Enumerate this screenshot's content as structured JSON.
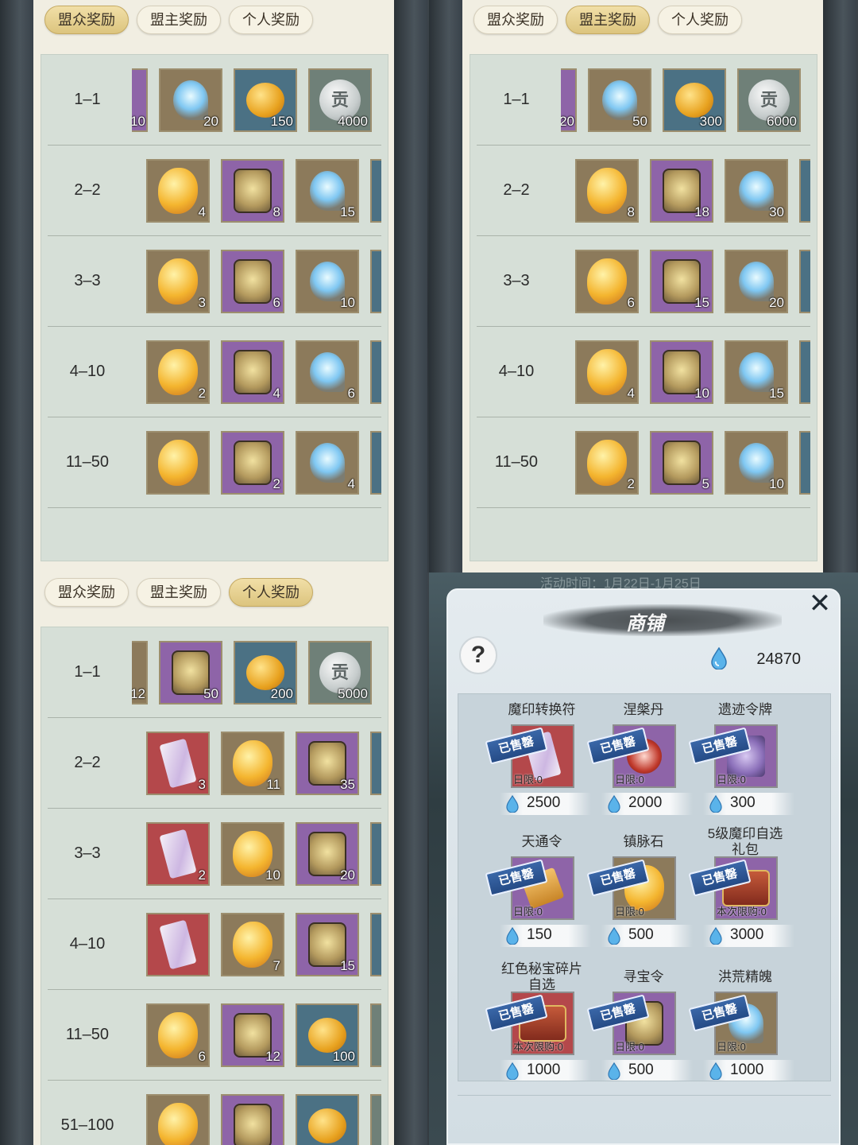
{
  "tabs": [
    "盟众奖励",
    "盟主奖励",
    "个人奖励"
  ],
  "panels": [
    {
      "active_tab": 0,
      "rows": [
        {
          "rank": "1–1",
          "items": [
            {
              "type": "partial-purple",
              "count": "10"
            },
            {
              "type": "swirl",
              "q": "brown",
              "count": "20"
            },
            {
              "type": "egg",
              "q": "blue",
              "count": "150"
            },
            {
              "type": "medal",
              "q": "gray",
              "count": "4000",
              "glyph": "贡"
            }
          ]
        },
        {
          "rank": "2–2",
          "items": [
            {
              "type": "stone",
              "q": "brown",
              "count": "4"
            },
            {
              "type": "token",
              "q": "purple",
              "count": "8"
            },
            {
              "type": "swirl",
              "q": "brown",
              "count": "15"
            },
            {
              "type": "partial-blue"
            }
          ]
        },
        {
          "rank": "3–3",
          "items": [
            {
              "type": "stone",
              "q": "brown",
              "count": "3"
            },
            {
              "type": "token",
              "q": "purple",
              "count": "6"
            },
            {
              "type": "swirl",
              "q": "brown",
              "count": "10"
            },
            {
              "type": "partial-blue"
            }
          ]
        },
        {
          "rank": "4–10",
          "items": [
            {
              "type": "stone",
              "q": "brown",
              "count": "2"
            },
            {
              "type": "token",
              "q": "purple",
              "count": "4"
            },
            {
              "type": "swirl",
              "q": "brown",
              "count": "6"
            },
            {
              "type": "partial-blue"
            }
          ]
        },
        {
          "rank": "11–50",
          "items": [
            {
              "type": "stone",
              "q": "brown",
              "count": ""
            },
            {
              "type": "token",
              "q": "purple",
              "count": "2"
            },
            {
              "type": "swirl",
              "q": "brown",
              "count": "4"
            },
            {
              "type": "partial-blue"
            }
          ]
        }
      ]
    },
    {
      "active_tab": 1,
      "rows": [
        {
          "rank": "1–1",
          "items": [
            {
              "type": "partial-purple",
              "count": "20"
            },
            {
              "type": "swirl",
              "q": "brown",
              "count": "50"
            },
            {
              "type": "egg",
              "q": "blue",
              "count": "300"
            },
            {
              "type": "medal",
              "q": "gray",
              "count": "6000",
              "glyph": "贡"
            }
          ]
        },
        {
          "rank": "2–2",
          "items": [
            {
              "type": "stone",
              "q": "brown",
              "count": "8"
            },
            {
              "type": "token",
              "q": "purple",
              "count": "18"
            },
            {
              "type": "swirl",
              "q": "brown",
              "count": "30"
            },
            {
              "type": "partial-blue"
            }
          ]
        },
        {
          "rank": "3–3",
          "items": [
            {
              "type": "stone",
              "q": "brown",
              "count": "6"
            },
            {
              "type": "token",
              "q": "purple",
              "count": "15"
            },
            {
              "type": "swirl",
              "q": "brown",
              "count": "20"
            },
            {
              "type": "partial-blue"
            }
          ]
        },
        {
          "rank": "4–10",
          "items": [
            {
              "type": "stone",
              "q": "brown",
              "count": "4"
            },
            {
              "type": "token",
              "q": "purple",
              "count": "10"
            },
            {
              "type": "swirl",
              "q": "brown",
              "count": "15"
            },
            {
              "type": "partial-blue"
            }
          ]
        },
        {
          "rank": "11–50",
          "items": [
            {
              "type": "stone",
              "q": "brown",
              "count": "2"
            },
            {
              "type": "token",
              "q": "purple",
              "count": "5"
            },
            {
              "type": "swirl",
              "q": "brown",
              "count": "10"
            },
            {
              "type": "partial-blue"
            }
          ]
        }
      ]
    },
    {
      "active_tab": 2,
      "rows": [
        {
          "rank": "1–1",
          "items": [
            {
              "type": "partial-brown",
              "count": "12"
            },
            {
              "type": "token",
              "q": "purple",
              "count": "50"
            },
            {
              "type": "egg",
              "q": "blue",
              "count": "200"
            },
            {
              "type": "medal",
              "q": "gray",
              "count": "5000",
              "glyph": "贡"
            }
          ]
        },
        {
          "rank": "2–2",
          "items": [
            {
              "type": "scroll",
              "q": "red",
              "count": "3"
            },
            {
              "type": "stone",
              "q": "brown",
              "count": "11"
            },
            {
              "type": "token",
              "q": "purple",
              "count": "35"
            },
            {
              "type": "partial-blue"
            }
          ]
        },
        {
          "rank": "3–3",
          "items": [
            {
              "type": "scroll",
              "q": "red",
              "count": "2"
            },
            {
              "type": "stone",
              "q": "brown",
              "count": "10"
            },
            {
              "type": "token",
              "q": "purple",
              "count": "20"
            },
            {
              "type": "partial-blue"
            }
          ]
        },
        {
          "rank": "4–10",
          "items": [
            {
              "type": "scroll",
              "q": "red",
              "count": ""
            },
            {
              "type": "stone",
              "q": "brown",
              "count": "7"
            },
            {
              "type": "token",
              "q": "purple",
              "count": "15"
            },
            {
              "type": "partial-blue"
            }
          ]
        },
        {
          "rank": "11–50",
          "items": [
            {
              "type": "stone",
              "q": "brown",
              "count": "6"
            },
            {
              "type": "token",
              "q": "purple",
              "count": "12"
            },
            {
              "type": "egg",
              "q": "blue",
              "count": "100"
            },
            {
              "type": "partial-gray"
            }
          ]
        },
        {
          "rank": "51–100",
          "items": [
            {
              "type": "stone",
              "q": "brown",
              "count": ""
            },
            {
              "type": "token",
              "q": "purple",
              "count": ""
            },
            {
              "type": "egg",
              "q": "blue",
              "count": ""
            },
            {
              "type": "partial-gray"
            }
          ]
        }
      ]
    }
  ],
  "shop": {
    "event_time": "活动时间：1月22日-1月25日",
    "title": "商铺",
    "close_glyph": "✕",
    "help_glyph": "?",
    "balance": "24870",
    "sold_label": "已售罄",
    "items": [
      {
        "name": "魔印转换符",
        "icon": "scroll",
        "q": "red",
        "limit": "日限:0",
        "price": "2500"
      },
      {
        "name": "涅槃丹",
        "icon": "fist",
        "q": "purple",
        "limit": "日限:0",
        "price": "2000"
      },
      {
        "name": "遗迹令牌",
        "icon": "badge",
        "q": "purple",
        "limit": "日限:0",
        "price": "300"
      },
      {
        "name": "天通令",
        "icon": "flag",
        "q": "purple",
        "limit": "日限:0",
        "price": "150"
      },
      {
        "name": "镇脉石",
        "icon": "stone",
        "q": "brown",
        "limit": "日限:0",
        "price": "500"
      },
      {
        "name": "5级魔印自选\n礼包",
        "icon": "chest",
        "q": "purple",
        "limit": "本次限购:0",
        "price": "3000"
      },
      {
        "name": "红色秘宝碎片\n自选",
        "icon": "chest",
        "q": "red",
        "limit": "本次限购:0",
        "price": "1000"
      },
      {
        "name": "寻宝令",
        "icon": "token",
        "q": "purple",
        "limit": "日限:0",
        "price": "500"
      },
      {
        "name": "洪荒精魄",
        "icon": "swirl",
        "q": "brown",
        "limit": "日限:0",
        "price": "1000"
      }
    ]
  },
  "colors": {
    "accent_tab": "#dcc47e",
    "sold_badge": "#2f5a98",
    "currency": "#4aa3e0"
  }
}
